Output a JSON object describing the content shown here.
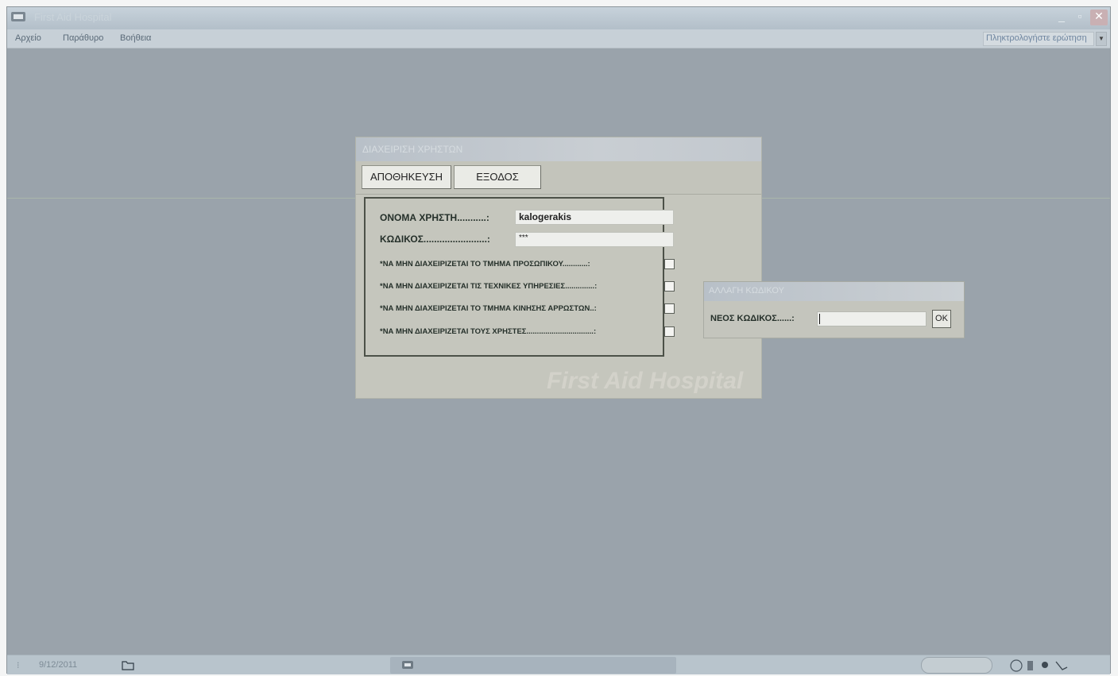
{
  "window": {
    "title": "First Aid Hospital"
  },
  "menu": {
    "items": [
      "Αρχείο",
      "Παράθυρο",
      "Βοήθεια"
    ],
    "help_placeholder": "Πληκτρολογήστε ερώτηση"
  },
  "user_form": {
    "title": "ΔΙΑΧΕΙΡΙΣΗ ΧΡΗΣΤΩΝ",
    "save_label": "ΑΠΟΘΗΚΕΥΣΗ",
    "exit_label": "ΕΞΟΔΟΣ",
    "username_label": "ΟΝΟΜΑ ΧΡΗΣΤΗ...........:",
    "username_value": "kalogerakis",
    "password_label": "ΚΩΔΙΚΟΣ........................:",
    "password_value": "***",
    "permissions": [
      {
        "label": "*ΝΑ ΜΗΝ ΔΙΑΧΕΙΡΙΖΕΤΑΙ ΤΟ ΤΜΗΜΑ ΠΡΟΣΩΠΙΚΟΥ............:",
        "checked": false
      },
      {
        "label": "*ΝΑ ΜΗΝ ΔΙΑΧΕΙΡΙΖΕΤΑΙ ΤΙΣ ΤΕΧΝΙΚΕΣ ΥΠΗΡΕΣΙΕΣ..............:",
        "checked": false
      },
      {
        "label": "*ΝΑ ΜΗΝ ΔΙΑΧΕΙΡΙΖΕΤΑΙ ΤΟ ΤΜΗΜΑ ΚΙΝΗΣΗΣ ΑΡΡΩΣΤΩΝ..:",
        "checked": false
      },
      {
        "label": "*ΝΑ ΜΗΝ ΔΙΑΧΕΙΡΙΖΕΤΑΙ ΤΟΥΣ ΧΡΗΣΤΕΣ................................:",
        "checked": false
      }
    ],
    "watermark": "First Aid Hospital"
  },
  "password_dialog": {
    "title": "ΑΛΛΑΓΗ ΚΩΔΙΚΟΥ",
    "label": "ΝΕΟΣ ΚΩΔΙΚΟΣ......:",
    "value": "",
    "ok_label": "OK"
  },
  "taskbar": {
    "date": "9/12/2011"
  }
}
